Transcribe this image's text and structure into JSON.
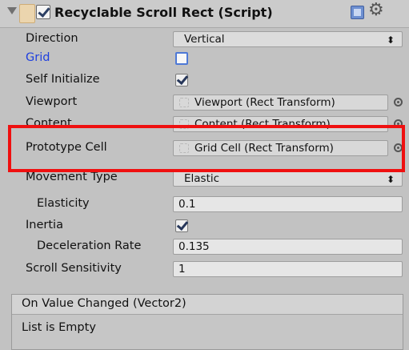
{
  "component": {
    "title": "Recyclable Scroll Rect (Script)",
    "enabled": true
  },
  "fields": {
    "direction": {
      "label": "Direction",
      "value": "Vertical"
    },
    "grid": {
      "label": "Grid",
      "checked": false
    },
    "self_initialize": {
      "label": "Self Initialize",
      "checked": true
    },
    "viewport": {
      "label": "Viewport",
      "value": "Viewport (Rect Transform)"
    },
    "content": {
      "label": "Content",
      "value": "Content (Rect Transform)"
    },
    "prototype_cell": {
      "label": "Prototype Cell",
      "value": "Grid Cell (Rect Transform)"
    },
    "movement_type": {
      "label": "Movement Type",
      "value": "Elastic"
    },
    "elasticity": {
      "label": "Elasticity",
      "value": "0.1"
    },
    "inertia": {
      "label": "Inertia",
      "checked": true
    },
    "deceleration_rate": {
      "label": "Deceleration Rate",
      "value": "0.135"
    },
    "scroll_sensitivity": {
      "label": "Scroll Sensitivity",
      "value": "1"
    }
  },
  "event": {
    "header": "On Value Changed (Vector2)",
    "empty_text": "List is Empty"
  },
  "icons": {
    "foldout": "foldout-triangle-icon",
    "script": "script-icon",
    "help": "help-book-icon",
    "settings": "gear-icon",
    "object_picker": "object-picker-icon"
  },
  "colors": {
    "highlight": "#ef1010",
    "grid_label": "#1e3fe0"
  }
}
